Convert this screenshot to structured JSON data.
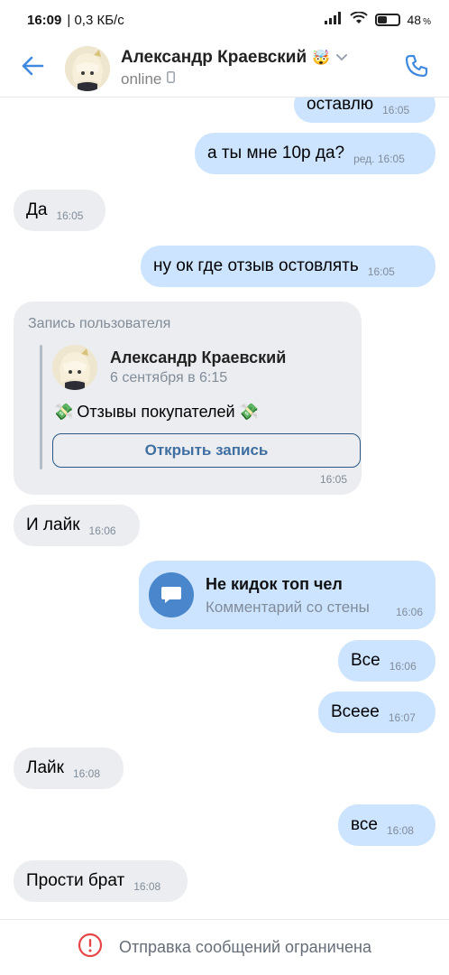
{
  "status_bar": {
    "time": "16:09",
    "speed": "| 0,3 КБ/с",
    "battery_level": "48",
    "battery_suffix": "%",
    "battery_fraction": 0.48
  },
  "header": {
    "title": "Александр Краевский",
    "title_emoji": "🤯",
    "status": "online",
    "icons": {
      "back": "back-arrow-icon",
      "avatar": "avatar",
      "chevron": "chevron-down-icon",
      "device": "mobile-device-icon",
      "call": "phone-icon"
    }
  },
  "messages": [
    {
      "dir": "out",
      "text": "оставлю",
      "time": "16:05"
    },
    {
      "dir": "out",
      "text": "а ты мне 10р да?",
      "time": "ред. 16:05"
    },
    {
      "dir": "in",
      "text": "Да",
      "time": "16:05"
    },
    {
      "dir": "out",
      "text": "ну ок где отзыв остовлять",
      "time": "16:05"
    },
    {
      "dir": "in",
      "text": "И лайк",
      "time": "16:06"
    },
    {
      "dir": "out",
      "text": "Все",
      "time": "16:06"
    },
    {
      "dir": "out",
      "text": "Всеее",
      "time": "16:07"
    },
    {
      "dir": "in",
      "text": "Лайк",
      "time": "16:08"
    },
    {
      "dir": "out",
      "text": "все",
      "time": "16:08"
    },
    {
      "dir": "in",
      "text": "Прости брат",
      "time": "16:08"
    }
  ],
  "repost": {
    "header": "Запись пользователя",
    "author": "Александр Краевский",
    "date": "6 сентября в 6:15",
    "text": "Отзывы покупателей",
    "emoji": "💸",
    "button": "Открыть запись",
    "time": "16:05"
  },
  "wall_comment": {
    "title": "Не кидок топ чел",
    "subtitle": "Комментарий со стены",
    "time": "16:06",
    "icon": "comment-icon"
  },
  "footer": {
    "text": "Отправка сообщений ограничена",
    "icon": "warning-icon"
  },
  "colors": {
    "accent": "#3f8ae0",
    "outgoing_bubble": "#cce4ff",
    "incoming_bubble": "#ebedf0",
    "warning": "#e64646"
  }
}
